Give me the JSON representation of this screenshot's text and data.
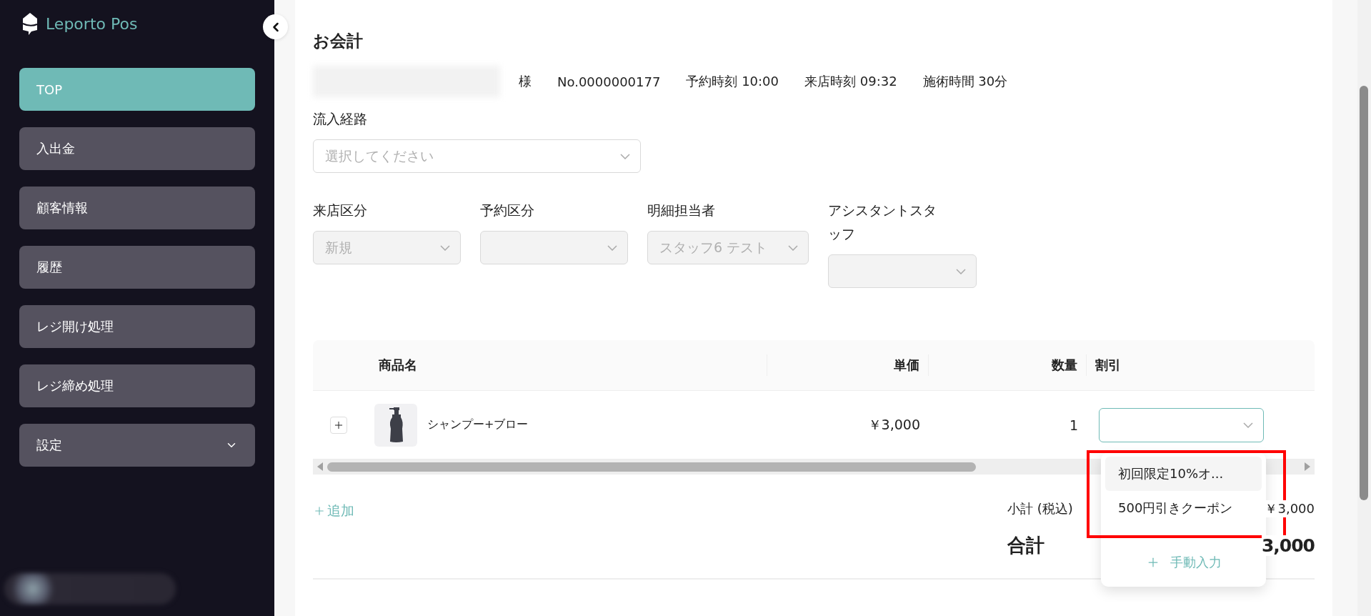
{
  "sidebar": {
    "logo": "Leporto Pos",
    "items": [
      {
        "label": "TOP",
        "selected": true,
        "expandable": false
      },
      {
        "label": "入出金",
        "selected": false,
        "expandable": false
      },
      {
        "label": "顧客情報",
        "selected": false,
        "expandable": false
      },
      {
        "label": "履歴",
        "selected": false,
        "expandable": false
      },
      {
        "label": "レジ開け処理",
        "selected": false,
        "expandable": false
      },
      {
        "label": "レジ締め処理",
        "selected": false,
        "expandable": false
      },
      {
        "label": "設定",
        "selected": false,
        "expandable": true
      }
    ]
  },
  "page_title": "お会計",
  "customer": {
    "suffix": "様",
    "fields": [
      "No.0000000177",
      "予約時刻 10:00",
      "来店時刻 09:32",
      "施術時間 30分"
    ]
  },
  "source": {
    "label": "流入経路",
    "placeholder": "選択してください"
  },
  "selects": [
    {
      "label": "来店区分",
      "value": "新規",
      "disabled": true
    },
    {
      "label": "予約区分",
      "disabled": true
    },
    {
      "label": "明細担当者",
      "value": "スタッフ6 テスト",
      "disabled": true
    },
    {
      "label": "アシスタントスタッフ",
      "disabled": true
    }
  ],
  "table": {
    "columns": [
      "商品名",
      "単価",
      "数量",
      "割引"
    ],
    "rows": [
      {
        "name": "シャンプー+ブロー",
        "price": "￥3,000",
        "quantity": "1",
        "discount_open": true
      }
    ]
  },
  "discount_menu": {
    "options": [
      {
        "label": "初回限定10%オ...",
        "selected": true
      },
      {
        "label": "500円引きクーポン",
        "selected": false
      }
    ],
    "manual": "手動入力"
  },
  "add_link": "追加",
  "summary": {
    "subtotal_label": "小計 (税込)",
    "subtotal": "￥3,000",
    "total_label": "合計",
    "total": "3,000"
  }
}
